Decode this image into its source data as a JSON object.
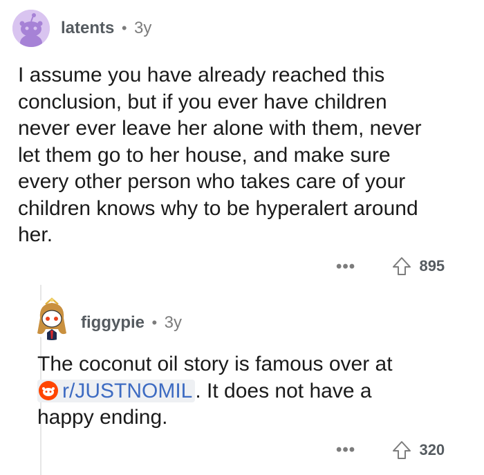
{
  "comment1": {
    "username": "latents",
    "separator": "•",
    "age": "3y",
    "lines": [
      "I assume you have already reached this",
      "conclusion, but if you ever have children",
      "never ever leave her alone with them, never",
      "let them go to her house, and make sure",
      "every other person who takes care of your",
      "children knows why to be hyperalert around",
      "her."
    ],
    "more": "•••",
    "score": "895"
  },
  "comment2": {
    "username": "figgypie",
    "separator": "•",
    "age": "3y",
    "line1": "The coconut oil story is famous over at",
    "subreddit": "r/JUSTNOMIL",
    "line2_rest": ". It does not have a",
    "line3": "happy ending.",
    "more": "•••",
    "score": "320"
  },
  "colors": {
    "link": "#3d6bc2",
    "upvote_icon": "#7c7c7c",
    "subreddit_badge": "#ff4500"
  }
}
